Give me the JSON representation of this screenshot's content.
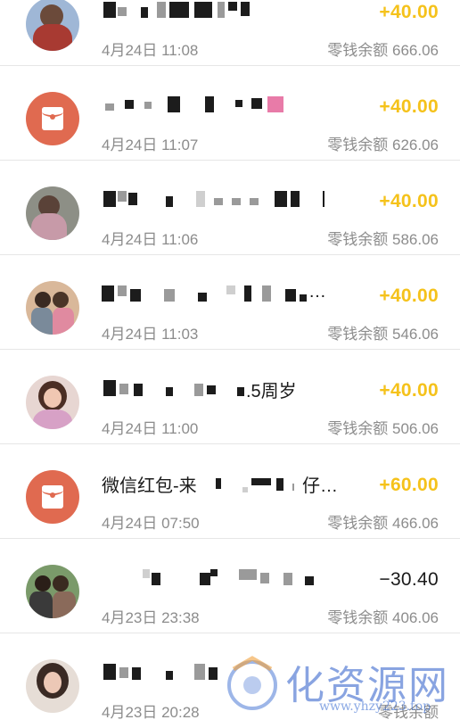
{
  "balance_label": "零钱余额",
  "transactions": [
    {
      "title": "",
      "time": "4月24日 11:08",
      "amount": "+40.00",
      "balance": "666.06",
      "avatar": "photo-avatar-icon"
    },
    {
      "title": "",
      "time": "4月24日 11:07",
      "amount": "+40.00",
      "balance": "626.06",
      "avatar": "red-packet-icon"
    },
    {
      "title": "",
      "time": "4月24日 11:06",
      "amount": "+40.00",
      "balance": "586.06",
      "avatar": "photo-avatar-icon"
    },
    {
      "title": "…",
      "time": "4月24日 11:03",
      "amount": "+40.00",
      "balance": "546.06",
      "avatar": "photo-avatar-icon"
    },
    {
      "title": ".5周岁",
      "time": "4月24日 11:00",
      "amount": "+40.00",
      "balance": "506.06",
      "avatar": "photo-avatar-icon"
    },
    {
      "title": "微信红包-来",
      "title_suffix": "仔…",
      "time": "4月24日 07:50",
      "amount": "+60.00",
      "balance": "466.06",
      "avatar": "red-packet-icon"
    },
    {
      "title": "",
      "time": "4月23日 23:38",
      "amount": "−30.40",
      "balance": "406.06",
      "avatar": "photo-avatar-icon"
    },
    {
      "title": "",
      "time": "4月23日 20:28",
      "amount": "",
      "balance": "",
      "avatar": "photo-avatar-icon"
    }
  ],
  "colors": {
    "income": "#f5c21b",
    "expense": "#1a1a1a",
    "red_packet": "#e06a50",
    "meta": "#8c8c8c"
  },
  "watermark": {
    "text": "化资源网",
    "url": "www.yhzy223.top"
  }
}
